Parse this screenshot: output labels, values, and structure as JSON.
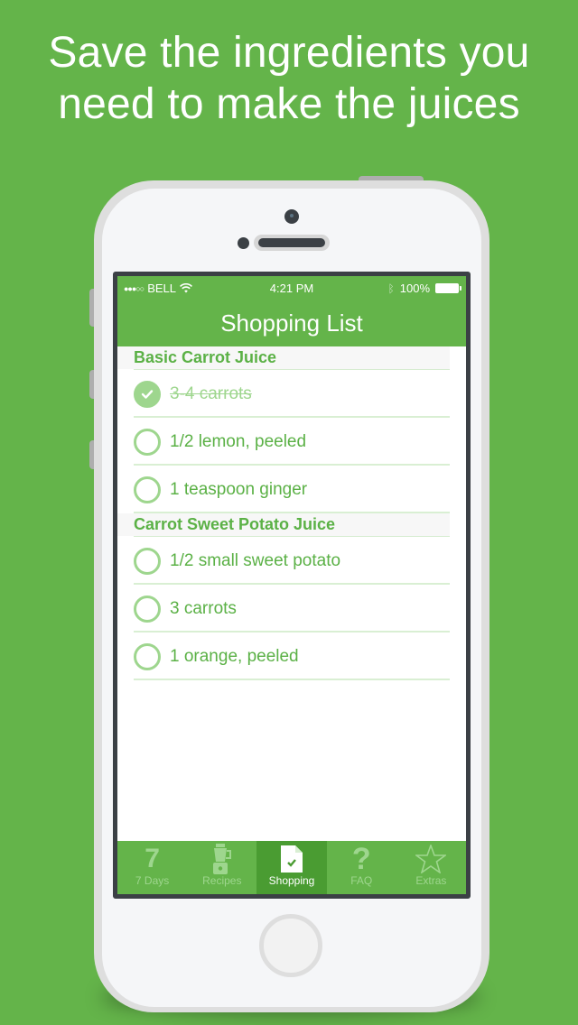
{
  "headline": {
    "line1": "Save the ingredients you",
    "line2": "need to make the juices"
  },
  "status_bar": {
    "signal": "●●●○○",
    "carrier": "BELL",
    "time": "4:21 PM",
    "battery": "100%",
    "bluetooth_icon": "ᛒ"
  },
  "nav": {
    "title": "Shopping List"
  },
  "sections": [
    {
      "title": "Basic Carrot Juice",
      "items": [
        {
          "label": "3-4 carrots",
          "checked": true
        },
        {
          "label": "1/2 lemon, peeled",
          "checked": false
        },
        {
          "label": "1 teaspoon ginger",
          "checked": false
        }
      ]
    },
    {
      "title": "Carrot Sweet Potato Juice",
      "items": [
        {
          "label": "1/2 small sweet potato",
          "checked": false
        },
        {
          "label": "3 carrots",
          "checked": false
        },
        {
          "label": "1 orange, peeled",
          "checked": false
        }
      ]
    }
  ],
  "tabs": [
    {
      "label": "7 Days",
      "icon": "seven-icon",
      "glyph": "7",
      "active": false
    },
    {
      "label": "Recipes",
      "icon": "blender-icon",
      "active": false
    },
    {
      "label": "Shopping",
      "icon": "checklist-document-icon",
      "active": true
    },
    {
      "label": "FAQ",
      "icon": "question-icon",
      "glyph": "?",
      "active": false
    },
    {
      "label": "Extras",
      "icon": "star-icon",
      "active": false
    }
  ],
  "colors": {
    "brand_green": "#64b44a",
    "active_tab": "#4a9c32",
    "light_green": "#9ed68e",
    "text_green": "#5bb146"
  }
}
